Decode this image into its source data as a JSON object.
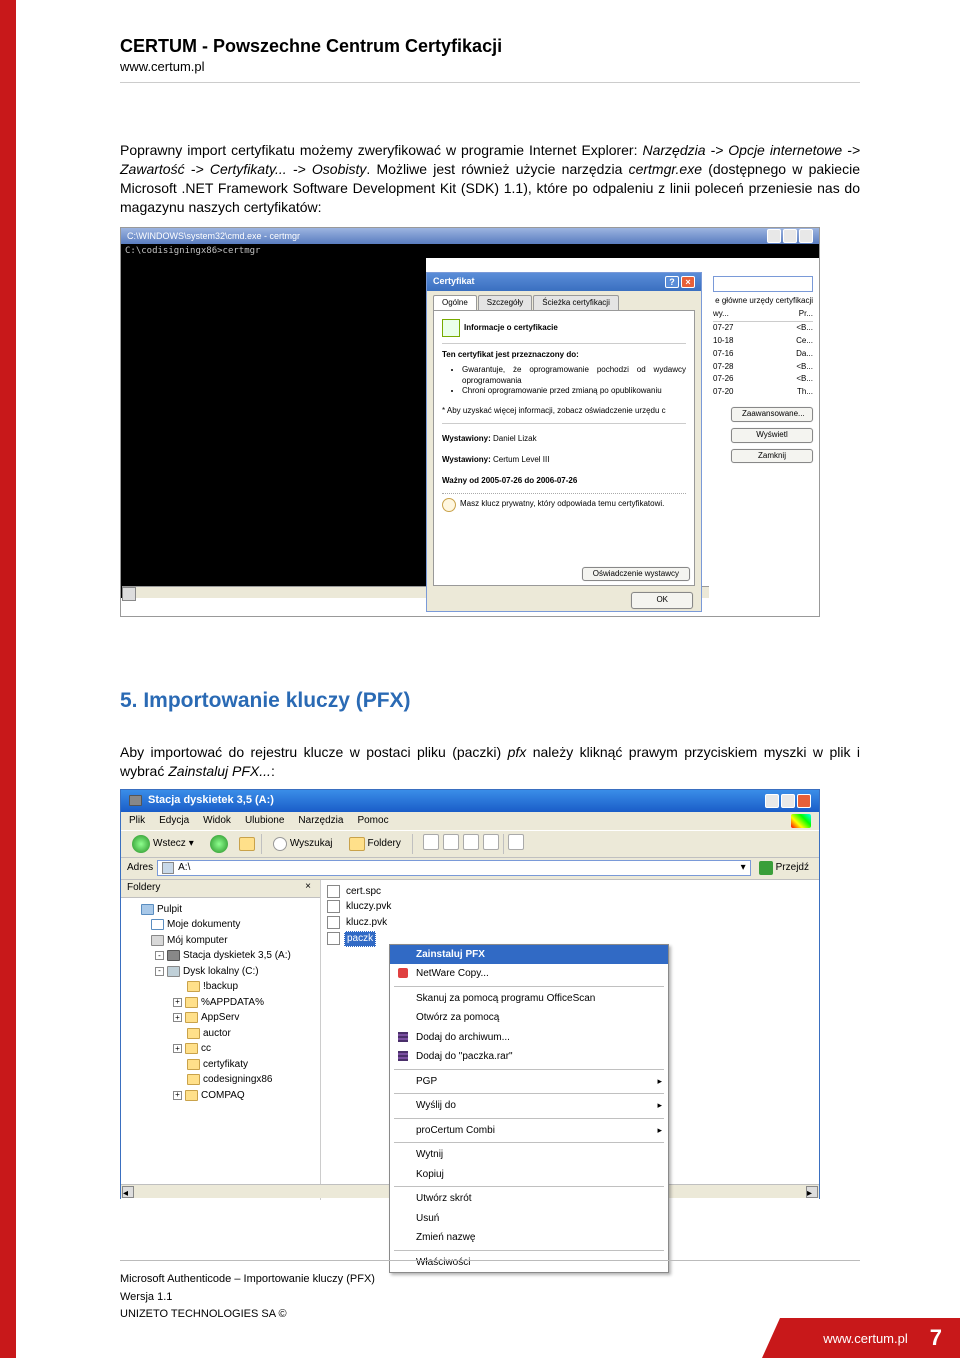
{
  "header": {
    "title": "CERTUM - Powszechne Centrum Certyfikacji",
    "url": "www.certum.pl"
  },
  "paragraphs": {
    "p1a": "Poprawny import certyfikatu możemy zweryfikować w programie Internet Explorer: ",
    "p1b": "Narzędzia -> Opcje internetowe -> Zawartość -> Certyfikaty... -> Osobisty",
    "p1c": ". Możliwe jest również użycie narzędzia ",
    "p1d": "certmgr.exe",
    "p1e": " (dostępnego w pakiecie Microsoft .NET Framework Software Development Kit (SDK) 1.1), które po odpaleniu z linii poleceń przeniesie nas do magazynu naszych certyfikatów:"
  },
  "screenshot1": {
    "titlebar": "C:\\WINDOWS\\system32\\cmd.exe - certmgr",
    "cmd_line": "C:\\codisigningx86>certmgr",
    "dialog": {
      "title": "Certyfikat",
      "tabs": [
        "Ogólne",
        "Szczegóły",
        "Ścieżka certyfikacji"
      ],
      "info_heading": "Informacje o certyfikacie",
      "purpose_heading": "Ten certyfikat jest przeznaczony do:",
      "purposes": [
        "Gwarantuje, że oprogramowanie pochodzi od wydawcy oprogramowania",
        "Chroni oprogramowanie przed zmianą po opublikowaniu"
      ],
      "note": "* Aby uzyskać więcej informacji, zobacz oświadczenie urzędu c",
      "issued_to_label": "Wystawiony:",
      "issued_to": "Daniel Lizak",
      "issued_by_label": "Wystawiony:",
      "issued_by": "Certum Level III",
      "valid_from": "Ważny od 2005-07-26 do 2006-07-26",
      "private_key": "Masz klucz prywatny, który odpowiada temu certyfikatowi.",
      "issuer_statement_btn": "Oświadczenie wystawcy",
      "ok_btn": "OK"
    },
    "right_panel": {
      "cert_stores_label": "e główne urzędy certyfikacji",
      "header_cols": [
        "wy...",
        "Pr..."
      ],
      "rows": [
        [
          "07-27",
          "<B..."
        ],
        [
          "10-18",
          "Ce..."
        ],
        [
          "07-16",
          "Da..."
        ],
        [
          "07-28",
          "<B..."
        ],
        [
          "07-26",
          "<B..."
        ],
        [
          "07-20",
          "Th..."
        ]
      ],
      "btn_advanced": "Zaawansowane...",
      "btn_view": "Wyświetl",
      "btn_close": "Zamknij"
    }
  },
  "section_heading": "5. Importowanie kluczy (PFX)",
  "p2a": "Aby importować do rejestru klucze w postaci pliku (paczki) ",
  "p2b": "pfx ",
  "p2c": "należy kliknąć prawym przyciskiem myszki w plik i wybrać ",
  "p2d": "Zainstaluj PFX...",
  "p2e": ":",
  "screenshot2": {
    "window_title": "Stacja dyskietek 3,5 (A:)",
    "menus": [
      "Plik",
      "Edycja",
      "Widok",
      "Ulubione",
      "Narzędzia",
      "Pomoc"
    ],
    "toolbar": {
      "back": "Wstecz",
      "search": "Wyszukaj",
      "folders": "Foldery"
    },
    "address_label": "Adres",
    "address_value": "A:\\",
    "go_label": "Przejdź",
    "sidebar_title": "Foldery",
    "tree": [
      {
        "lvl": "l1",
        "exp": "",
        "icon": "desktop",
        "label": "Pulpit"
      },
      {
        "lvl": "l2",
        "exp": "",
        "icon": "docs",
        "label": "Moje dokumenty"
      },
      {
        "lvl": "l2",
        "exp": "",
        "icon": "comp",
        "label": "Mój komputer"
      },
      {
        "lvl": "l3",
        "exp": "-",
        "icon": "floppy",
        "label": "Stacja dyskietek 3,5 (A:)"
      },
      {
        "lvl": "l3",
        "exp": "-",
        "icon": "drive",
        "label": "Dysk lokalny (C:)"
      },
      {
        "lvl": "l4",
        "exp": "",
        "icon": "folder",
        "label": "!backup"
      },
      {
        "lvl": "l4",
        "exp": "+",
        "icon": "folder",
        "label": "%APPDATA%"
      },
      {
        "lvl": "l4",
        "exp": "+",
        "icon": "folder",
        "label": "AppServ"
      },
      {
        "lvl": "l4",
        "exp": "",
        "icon": "folder",
        "label": "auctor"
      },
      {
        "lvl": "l4",
        "exp": "+",
        "icon": "folder",
        "label": "cc"
      },
      {
        "lvl": "l4",
        "exp": "",
        "icon": "folder",
        "label": "certyfikaty"
      },
      {
        "lvl": "l4",
        "exp": "",
        "icon": "folder",
        "label": "codesigningx86"
      },
      {
        "lvl": "l4",
        "exp": "+",
        "icon": "folder",
        "label": "COMPAQ"
      }
    ],
    "files": [
      {
        "name": "cert.spc",
        "sel": false
      },
      {
        "name": "kluczy.pvk",
        "sel": false
      },
      {
        "name": "klucz.pvk",
        "sel": false
      },
      {
        "name": "paczk",
        "sel": true
      }
    ],
    "context": [
      {
        "type": "item",
        "text": "Zainstaluj PFX",
        "cls": "selected bold"
      },
      {
        "type": "item",
        "text": "NetWare Copy...",
        "nicon": true
      },
      {
        "type": "sep"
      },
      {
        "type": "item",
        "text": "Skanuj za pomocą programu OfficeScan"
      },
      {
        "type": "item",
        "text": "Otwórz za pomocą"
      },
      {
        "type": "item",
        "text": "Dodaj do archiwum...",
        "rar": true
      },
      {
        "type": "item",
        "text": "Dodaj do \"paczka.rar\"",
        "rar": true
      },
      {
        "type": "sep"
      },
      {
        "type": "item",
        "text": "PGP",
        "sub": true
      },
      {
        "type": "sep"
      },
      {
        "type": "item",
        "text": "Wyślij do",
        "sub": true
      },
      {
        "type": "sep"
      },
      {
        "type": "item",
        "text": "proCertum Combi",
        "sub": true
      },
      {
        "type": "sep"
      },
      {
        "type": "item",
        "text": "Wytnij"
      },
      {
        "type": "item",
        "text": "Kopiuj"
      },
      {
        "type": "sep"
      },
      {
        "type": "item",
        "text": "Utwórz skrót"
      },
      {
        "type": "item",
        "text": "Usuń"
      },
      {
        "type": "item",
        "text": "Zmień nazwę"
      },
      {
        "type": "sep"
      },
      {
        "type": "item",
        "text": "Właściwości"
      }
    ]
  },
  "footer": {
    "line1": "Microsoft Authenticode  –  Importowanie kluczy (PFX)",
    "line2": "Wersja 1.1",
    "line3": "UNIZETO TECHNOLOGIES SA ©"
  },
  "badge": {
    "url": "www.certum.pl",
    "page": "7"
  }
}
